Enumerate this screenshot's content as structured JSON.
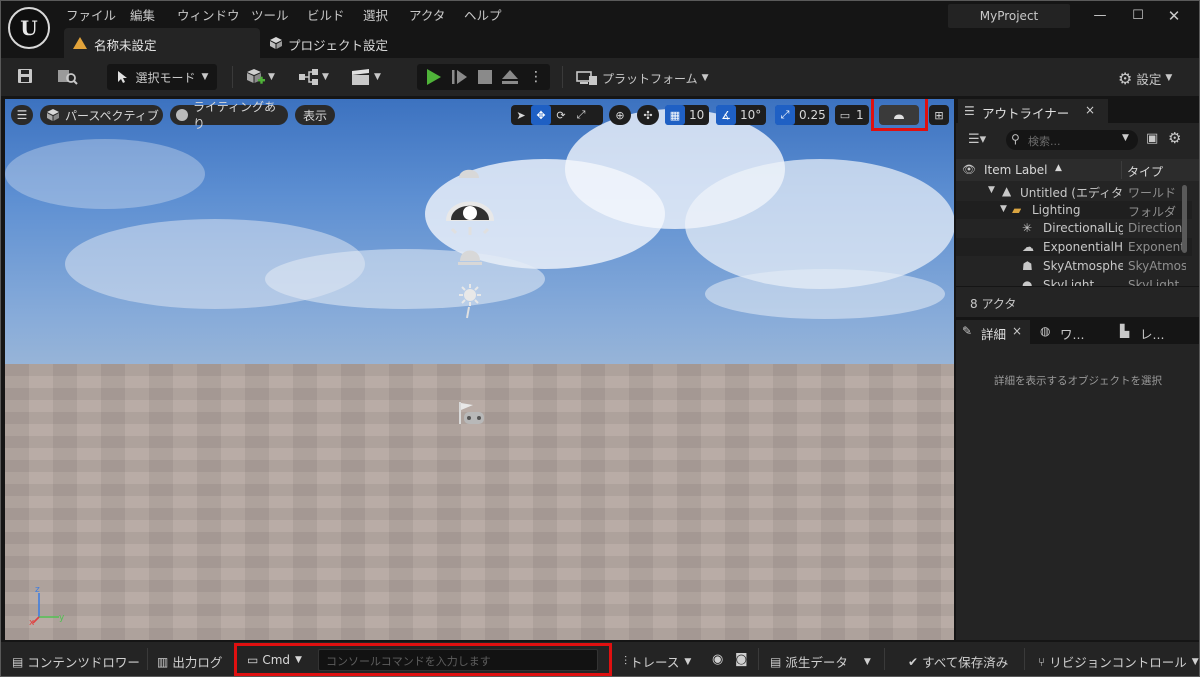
{
  "menu": [
    "ファイル",
    "編集",
    "ウィンドウ",
    "ツール",
    "ビルド",
    "選択",
    "アクタ",
    "ヘルプ"
  ],
  "project_name": "MyProject",
  "tabs": {
    "level_tab": "名称未設定",
    "project_settings_tab": "プロジェクト設定"
  },
  "toolbar": {
    "select_mode": "選択モード",
    "platforms": "プラットフォーム",
    "settings": "設定"
  },
  "viewport": {
    "perspective": "パースペクティブ",
    "lighting": "ライティングあり",
    "show": "表示",
    "grid_snap": "10",
    "rotation_snap": "10°",
    "scale_snap": "0.25",
    "camera_speed": "1"
  },
  "outliner": {
    "tab_title": "アウトライナー",
    "search_placeholder": "検索...",
    "col_label": "Item Label",
    "col_type": "タイプ",
    "rows": [
      {
        "name": "Untitled (エディタ)",
        "type": "ワールド"
      },
      {
        "name": "Lighting",
        "type": "フォルダ"
      },
      {
        "name": "DirectionalLight",
        "type": "DirectionalLight"
      },
      {
        "name": "ExponentialHeightFog",
        "type": "ExponentialHeightFog"
      },
      {
        "name": "SkyAtmosphere",
        "type": "SkyAtmosphere"
      },
      {
        "name": "SkyLight",
        "type": "SkyLight"
      }
    ],
    "actor_count": "8 アクタ"
  },
  "details": {
    "tab_details": "詳細",
    "tab_world": "ワ...",
    "tab_level": "レ...",
    "empty_message": "詳細を表示するオブジェクトを選択"
  },
  "bottombar": {
    "content_drawer": "コンテンツドロワー",
    "output_log": "出力ログ",
    "cmd": "Cmd",
    "console_placeholder": "コンソールコマンドを入力します",
    "trace": "トレース",
    "derived_data": "派生データ",
    "save_all": "すべて保存済み",
    "revision_control": "リビジョンコントロール"
  },
  "colors": {
    "accent_blue": "#1f60c4",
    "highlight_red": "#e01010",
    "play_green": "#4fb339",
    "warning": "#e2a33a"
  }
}
